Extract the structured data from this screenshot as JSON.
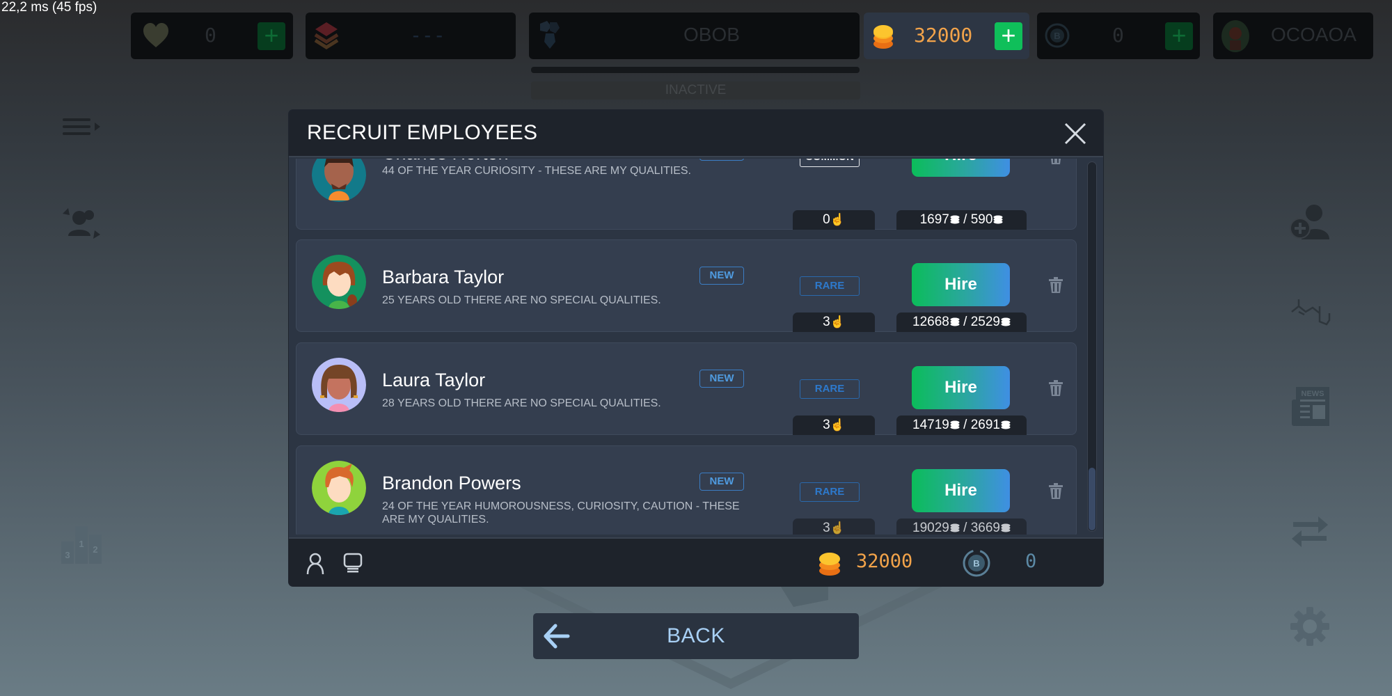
{
  "debug": {
    "fps_text": "22,2 ms (45 fps)"
  },
  "topbar": {
    "hearts": {
      "icon": "heart-icon",
      "value": "0",
      "add_label": "+"
    },
    "layers": {
      "icon": "layers-icon",
      "value": "---"
    },
    "crystals": {
      "icon": "hexagon-cluster-icon",
      "value": "OBOB",
      "status": "INACTIVE"
    },
    "coins": {
      "icon": "coin-stack-icon",
      "value": "32000",
      "add_label": "+"
    },
    "bitcoin": {
      "icon": "bitcoin-icon",
      "value": "0",
      "add_label": "+"
    },
    "profile": {
      "icon": "avatar-icon",
      "value": "OCOAOA"
    }
  },
  "left_sidebar": [
    {
      "name": "menu",
      "icon": "menu-icon"
    },
    {
      "name": "staff-swap",
      "icon": "people-swap-icon"
    },
    {
      "name": "leaderboard",
      "icon": "podium-icon"
    }
  ],
  "right_sidebar": [
    {
      "name": "recruit",
      "icon": "add-user-icon"
    },
    {
      "name": "research",
      "icon": "molecule-icon"
    },
    {
      "name": "news",
      "icon": "newspaper-icon"
    },
    {
      "name": "trade",
      "icon": "exchange-icon"
    },
    {
      "name": "settings",
      "icon": "gear-icon"
    }
  ],
  "modal": {
    "title": "RECRUIT EMPLOYEES",
    "candidates": [
      {
        "name": "Charles Horton",
        "description": "44 OF THE YEAR CURIOSITY - THESE ARE MY QUALITIES.",
        "badge": "NEW",
        "rarity": "COMMON",
        "clicks": "0",
        "hire_label": "Hire",
        "cost": "1697",
        "salary": "590",
        "avatar_bg": "#127a8a"
      },
      {
        "name": "Barbara Taylor",
        "description": "25 YEARS OLD THERE ARE NO SPECIAL QUALITIES.",
        "badge": "NEW",
        "rarity": "RARE",
        "clicks": "3",
        "hire_label": "Hire",
        "cost": "12668",
        "salary": "2529",
        "avatar_bg": "#14915e"
      },
      {
        "name": "Laura Taylor",
        "description": "28 YEARS OLD THERE ARE NO SPECIAL QUALITIES.",
        "badge": "NEW",
        "rarity": "RARE",
        "clicks": "3",
        "hire_label": "Hire",
        "cost": "14719",
        "salary": "2691",
        "avatar_bg": "#b9bef7"
      },
      {
        "name": "Brandon Powers",
        "description": "24 OF THE YEAR HUMOROUSNESS, CURIOSITY, CAUTION - THESE ARE MY QUALITIES.",
        "badge": "NEW",
        "rarity": "RARE",
        "clicks": "3",
        "hire_label": "Hire",
        "cost": "19029",
        "salary": "3669",
        "avatar_bg": "#8fd33c"
      }
    ],
    "scroll_position": 0.85,
    "footer": {
      "coins": "32000",
      "bitcoin": "0"
    }
  },
  "back_button": {
    "label": "BACK"
  },
  "colors": {
    "accent_green": "#0bbd5a",
    "accent_blue": "#3f8fe3",
    "coin_orange": "#f2a34a",
    "rare_blue": "#2d79cc"
  }
}
